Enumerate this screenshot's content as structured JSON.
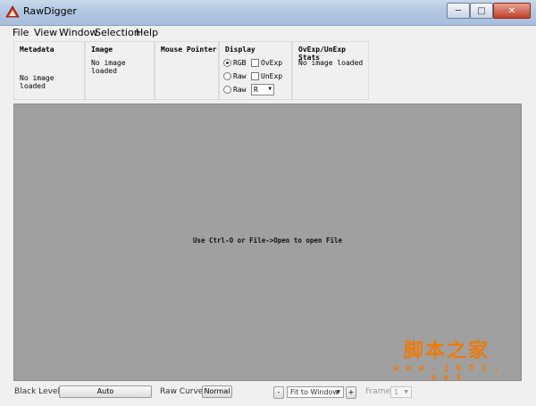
{
  "window": {
    "title": "RawDigger"
  },
  "menu": [
    "File",
    "View",
    "Window",
    "Selection",
    "Help"
  ],
  "panels": {
    "metadata": {
      "title": "Metadata",
      "text": "No image loaded"
    },
    "image": {
      "title": "Image",
      "text": "No image loaded"
    },
    "mouse": {
      "title": "Mouse Pointer"
    },
    "display": {
      "title": "Display",
      "rgb_label": "RGB",
      "raw_label_1": "Raw",
      "raw_label_2": "Raw",
      "ovexp_label": "OvExp",
      "unexp_label": "UnExp",
      "channel_value": "R",
      "selected": "RGB"
    },
    "stats": {
      "title": "OvExp/UnExp Stats",
      "text": "No image loaded"
    }
  },
  "canvas": {
    "message": "Use Ctrl-O or File->Open to open File"
  },
  "watermark": {
    "cn": "脚本之家",
    "url": "w w w . j b 5 1 . n e t"
  },
  "bottom": {
    "black_level_label": "Black Level:",
    "black_level_value": "Auto",
    "raw_curve_label": "Raw Curve:",
    "raw_curve_value": "Normal",
    "zoom_minus": "-",
    "zoom_value": "Fit to Window",
    "zoom_plus": "+",
    "frame_label": "Frame:",
    "frame_value": "1"
  }
}
